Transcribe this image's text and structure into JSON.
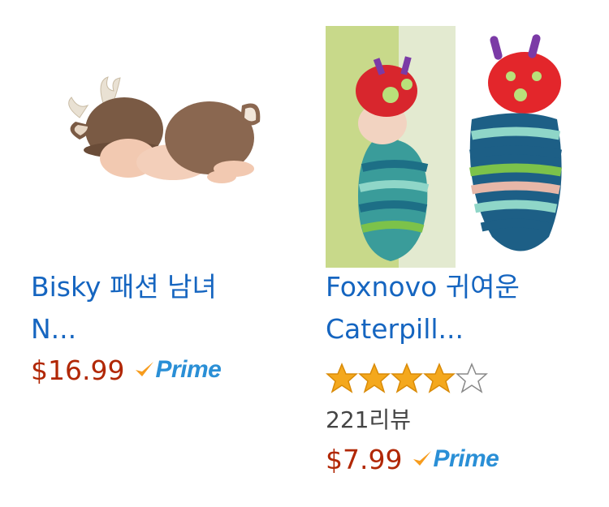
{
  "products": [
    {
      "title_line1": "Bisky 패션 남녀",
      "title_line2": "N...",
      "price": "$16.99",
      "prime_label": "Prime",
      "image_icon": "baby-deer-costume-photo"
    },
    {
      "title_line1": "Foxnovo 귀여운",
      "title_line2": "Caterpill...",
      "price": "$7.99",
      "prime_label": "Prime",
      "rating": 4,
      "rating_max": 5,
      "reviews": "221리뷰",
      "image_icon": "baby-caterpillar-costume-photo"
    }
  ],
  "colors": {
    "title": "#1565c0",
    "price": "#b12704",
    "prime": "#2a8fd6",
    "prime_check": "#f79c1d",
    "star": "#f4a81d"
  }
}
